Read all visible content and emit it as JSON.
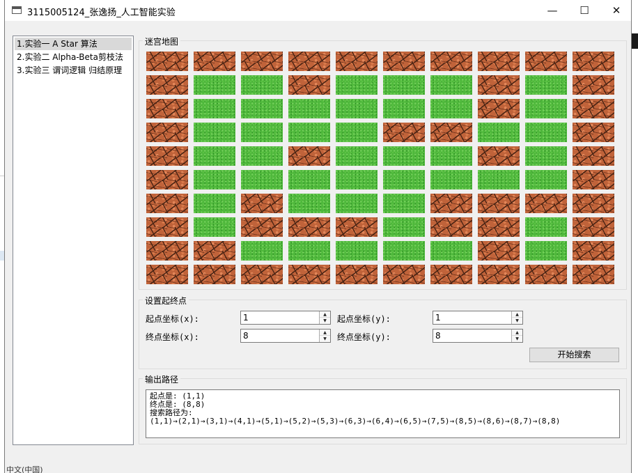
{
  "window": {
    "title": "3115005124_张逸扬_人工智能实验",
    "min_glyph": "—",
    "max_glyph": "☐",
    "close_glyph": "✕"
  },
  "status_bar": {
    "text": "中文(中国)"
  },
  "experiments": [
    {
      "label": "1.实验一  A Star 算法",
      "selected": true
    },
    {
      "label": "2.实验二  Alpha-Beta剪枝法",
      "selected": false
    },
    {
      "label": "3.实验三  谓词逻辑 归结原理",
      "selected": false
    }
  ],
  "maze": {
    "title": "迷宫地图",
    "legend": {
      "wall": "brick",
      "path": "grass"
    },
    "grid": [
      [
        1,
        1,
        1,
        1,
        1,
        1,
        1,
        1,
        1,
        1
      ],
      [
        1,
        0,
        0,
        1,
        0,
        0,
        0,
        1,
        0,
        1
      ],
      [
        1,
        0,
        0,
        0,
        0,
        0,
        0,
        1,
        0,
        1
      ],
      [
        1,
        0,
        0,
        0,
        0,
        1,
        1,
        0,
        0,
        1
      ],
      [
        1,
        0,
        0,
        1,
        0,
        0,
        0,
        1,
        0,
        1
      ],
      [
        1,
        0,
        0,
        0,
        0,
        0,
        0,
        0,
        0,
        1
      ],
      [
        1,
        0,
        1,
        0,
        0,
        0,
        1,
        1,
        1,
        1
      ],
      [
        1,
        0,
        1,
        1,
        1,
        0,
        1,
        1,
        0,
        1
      ],
      [
        1,
        1,
        0,
        0,
        0,
        0,
        0,
        1,
        0,
        1
      ],
      [
        1,
        1,
        1,
        1,
        1,
        1,
        1,
        1,
        1,
        1
      ]
    ]
  },
  "setup": {
    "title": "设置起终点",
    "start_x_label": "起点坐标(x):",
    "start_y_label": "起点坐标(y):",
    "end_x_label": "终点坐标(x):",
    "end_y_label": "终点坐标(y):",
    "start_x": "1",
    "start_y": "1",
    "end_x": "8",
    "end_y": "8",
    "search_button": "开始搜索"
  },
  "output": {
    "title": "输出路径",
    "line1": "起点是: (1,1)",
    "line2": "终点是: (8,8)",
    "line3": "搜索路径为:",
    "line4": "(1,1)→(2,1)→(3,1)→(4,1)→(5,1)→(5,2)→(5,3)→(6,3)→(6,4)→(6,5)→(7,5)→(8,5)→(8,6)→(8,7)→(8,8)"
  }
}
